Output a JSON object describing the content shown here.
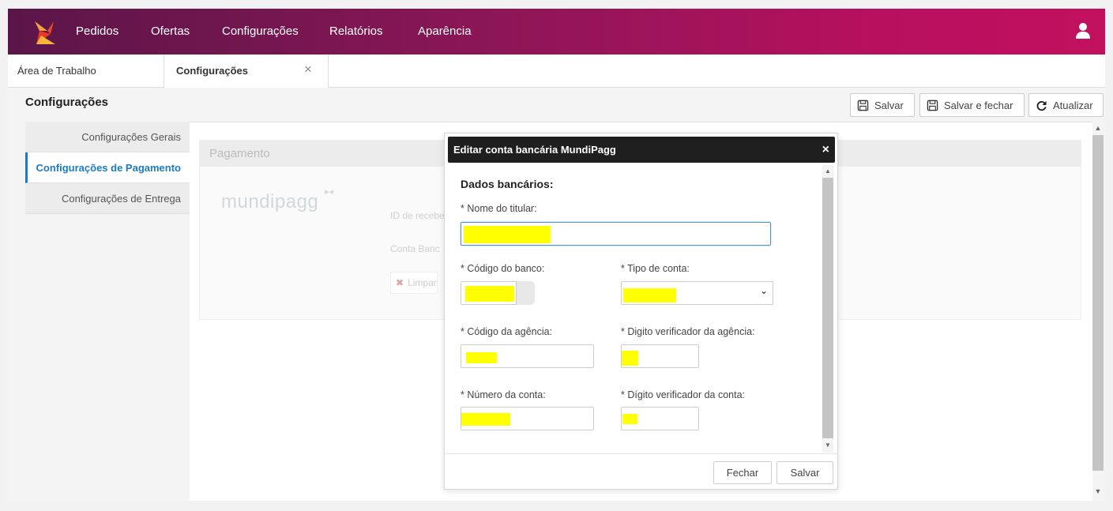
{
  "nav": {
    "items": [
      "Pedidos",
      "Ofertas",
      "Configurações",
      "Relatórios",
      "Aparência"
    ]
  },
  "tabs": [
    {
      "label": "Área de Trabalho"
    },
    {
      "label": "Configurações",
      "close": "×"
    }
  ],
  "page": {
    "title": "Configurações",
    "toolbar": {
      "save_label": "Salvar",
      "save_close_label": "Salvar e fechar",
      "refresh_label": "Atualizar"
    }
  },
  "sidebar": {
    "items": [
      {
        "label": "Configurações Gerais"
      },
      {
        "label": "Configurações de Pagamento",
        "active": true
      },
      {
        "label": "Configurações de Entrega"
      }
    ]
  },
  "panel": {
    "title": "Pagamento",
    "logo_text": "mundipagg",
    "label_id": "ID de recebe",
    "label_conta": "Conta Banc",
    "clear_label": "Limpar"
  },
  "modal": {
    "title": "Editar conta bancária MundiPagg",
    "close": "×",
    "section": "Dados bancários:",
    "fields": {
      "holder_label": "* Nome do titular:",
      "bank_code_label": "* Código do banco:",
      "account_type_label": "* Tipo de conta:",
      "agency_label": "* Código da agência:",
      "agency_digit_label": "* Digito verificador da agência:",
      "account_number_label": "* Número da conta:",
      "account_digit_label": "* Dígito verificador da conta:"
    },
    "footer": {
      "close_label": "Fechar",
      "save_label": "Salvar"
    }
  },
  "colors": {
    "nav_gradient_start": "#5a1648",
    "nav_gradient_end": "#c1105e",
    "active_blue": "#1a7bc4",
    "redaction": "#ffff00"
  }
}
